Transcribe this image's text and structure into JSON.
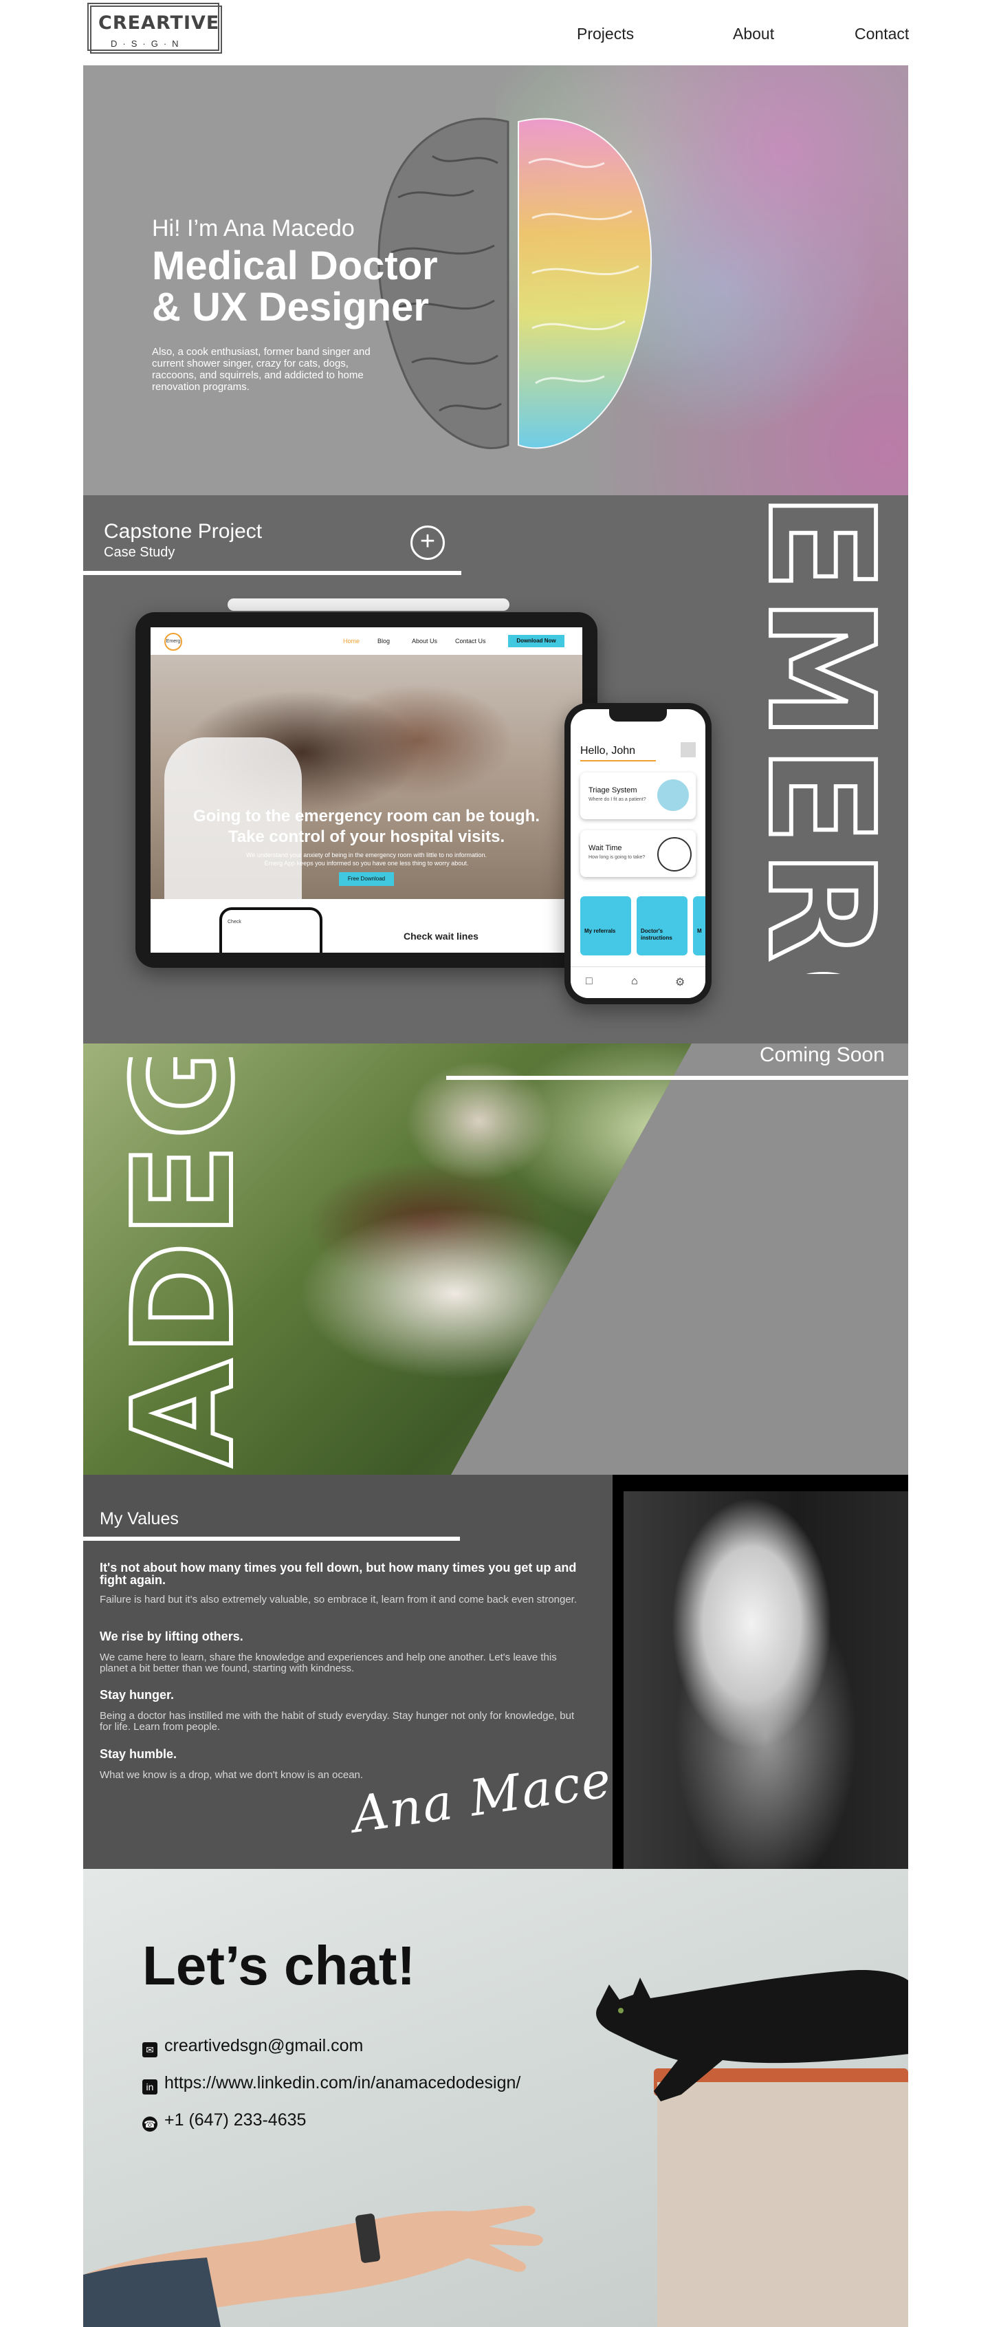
{
  "nav": {
    "logo_main": "CREARTIVE",
    "logo_sub": "D·S·G·N",
    "links": [
      "Projects",
      "About",
      "Contact"
    ]
  },
  "hero": {
    "greeting": "Hi! I’m Ana Macedo",
    "title_line1": "Medical Doctor",
    "title_line2": "& UX Designer",
    "description": "Also, a cook enthusiast, former band singer and current shower singer, crazy for cats, dogs, raccoons, and squirrels, and addicted to home renovation programs."
  },
  "capstone": {
    "title": "Capstone Project",
    "subtitle": "Case Study",
    "expand_icon": "plus-circle-icon",
    "vertical_word": "EMERG"
  },
  "emerg_tablet": {
    "logo": "Emerg",
    "nav": [
      "Home",
      "Blog",
      "About Us",
      "Contact Us"
    ],
    "download_label": "Download Now",
    "headline_line1": "Going to the emergency room can be tough.",
    "headline_line2": "Take control of your hospital visits.",
    "body_line1": "We understand your anxiety of being in the emergency room with little to no information.",
    "body_line2": "Emerg App keeps you informed so you have one less thing to worry about.",
    "button": "Free Download",
    "mini_phone_label": "Check",
    "section_heading": "Check wait lines"
  },
  "emerg_phone": {
    "greeting": "Hello, John",
    "cards": [
      {
        "title": "Triage System",
        "subtitle": "Where do I fit as a patient?"
      },
      {
        "title": "Wait Time",
        "subtitle": "How long is going to take?"
      }
    ],
    "tiles": [
      "My referrals",
      "Doctor's instructions",
      "M"
    ]
  },
  "adega": {
    "coming_soon": "Coming Soon",
    "vertical_word": "ADEGA"
  },
  "values": {
    "title": "My Values",
    "items": [
      {
        "heading": "It's not about how many times you fell down, but how many times you get up and fight again.",
        "body": "Failure is hard but it's also extremely valuable, so embrace it, learn from it and come back even stronger."
      },
      {
        "heading": "We rise by lifting others.",
        "body": "We came here to learn, share the knowledge and experiences and help one another. Let's leave this planet a bit better than we found, starting with kindness."
      },
      {
        "heading": "Stay hunger.",
        "body": "Being a doctor has instilled me with the habit of study everyday. Stay hunger not only for knowledge, but for life. Learn from people."
      },
      {
        "heading": "Stay humble.",
        "body": "What we know is a drop, what we don't know is an ocean."
      }
    ],
    "signature": "Ana Macedo"
  },
  "chat": {
    "title": "Let’s chat!",
    "email": "creartivedsgn@gmail.com",
    "linkedin": "https://www.linkedin.com/in/anamacedodesign/",
    "phone": "+1 (647) 233-4635"
  }
}
